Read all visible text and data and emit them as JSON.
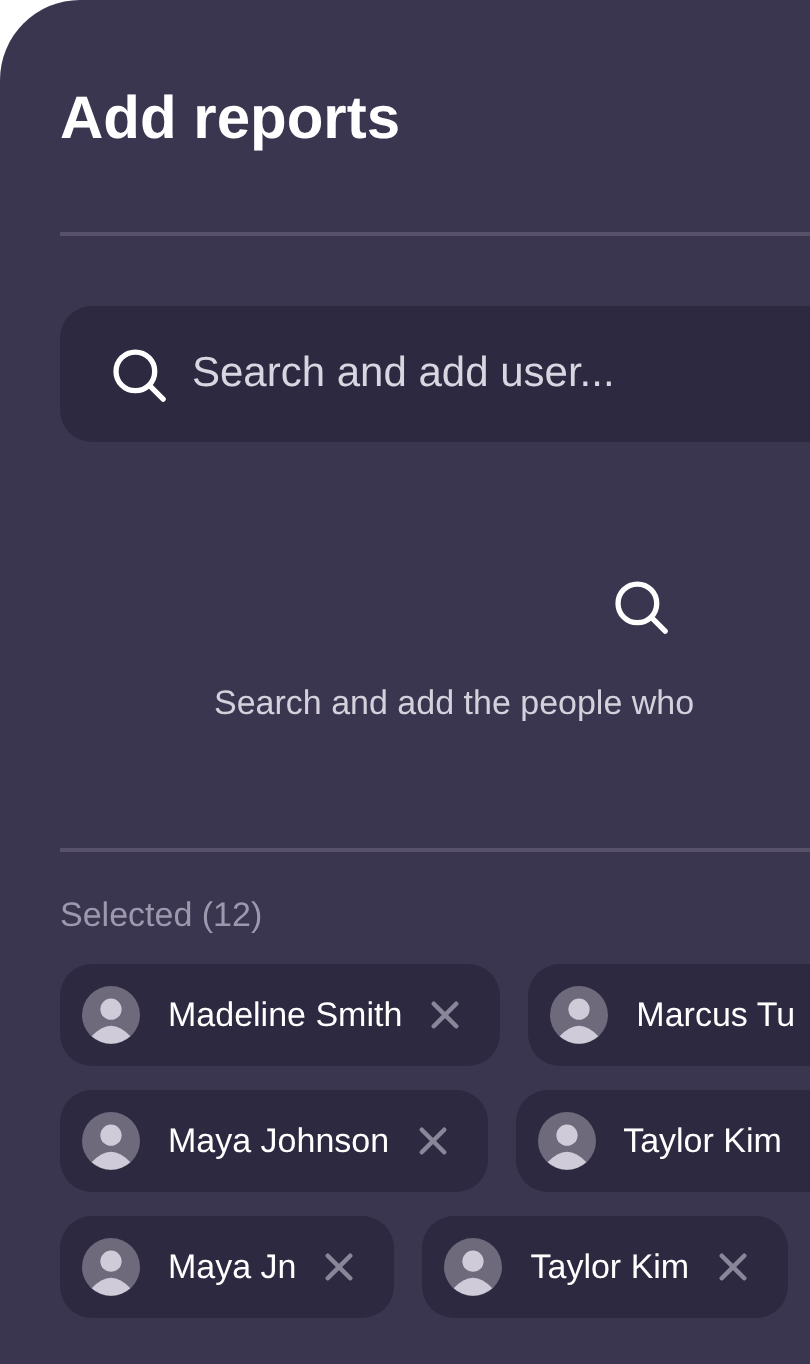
{
  "dialog": {
    "title": "Add reports"
  },
  "search": {
    "placeholder": "Search and add user..."
  },
  "empty_state": {
    "message": "Search and add the people who"
  },
  "selected": {
    "label": "Selected (12)",
    "rows": [
      [
        {
          "name": "Madeline Smith"
        },
        {
          "name": "Marcus Tu"
        }
      ],
      [
        {
          "name": "Maya Johnson"
        },
        {
          "name": "Taylor Kim"
        }
      ],
      [
        {
          "name": "Maya Jn"
        },
        {
          "name": "Taylor Kim"
        }
      ]
    ]
  }
}
